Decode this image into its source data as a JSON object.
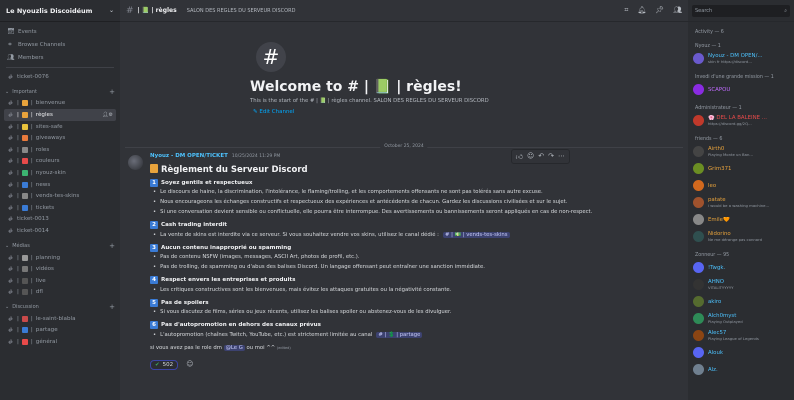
{
  "server": {
    "name": "Le Nyouzlis Discoidéum"
  },
  "nav": [
    "Events",
    "Browse Channels",
    "Members"
  ],
  "top_channel": "ticket-0076",
  "categories": [
    {
      "name": "Important",
      "channels": [
        {
          "name": "bienvenue",
          "emo": "#e8a33c"
        },
        {
          "name": "règles",
          "emo": "#e8a33c",
          "active": true
        },
        {
          "name": "sites-safe",
          "emo": "#e8c23c"
        },
        {
          "name": "giveaways",
          "emo": "#e87a3c"
        },
        {
          "name": "roles",
          "emo": "#888"
        },
        {
          "name": "couleurs",
          "emo": "#e84a4a"
        },
        {
          "name": "nyouz-skin",
          "emo": "#3cb371"
        },
        {
          "name": "news",
          "emo": "#3a7bd5"
        },
        {
          "name": "vends-tes-skins",
          "emo": "#888"
        },
        {
          "name": "tickets",
          "emo": "#3a7bd5"
        },
        {
          "name": "ticket-0013"
        },
        {
          "name": "ticket-0014"
        }
      ]
    },
    {
      "name": "Médias",
      "channels": [
        {
          "name": "planning",
          "emo": "#999"
        },
        {
          "name": "vidéos",
          "emo": "#777"
        },
        {
          "name": "live",
          "emo": "#555"
        },
        {
          "name": "dfl",
          "emo": "#555"
        }
      ]
    },
    {
      "name": "Discussion",
      "channels": [
        {
          "name": "le-saint-blabla",
          "emo": "#c94a4a"
        },
        {
          "name": "partage",
          "emo": "#3a7bd5"
        },
        {
          "name": "général",
          "emo": "#e84a4a"
        }
      ]
    }
  ],
  "header": {
    "channel": "| 📗 | règles",
    "topic": "SALON DES REGLES DU SERVEUR DISCORD",
    "search_placeholder": "Search"
  },
  "welcome": {
    "title": "Welcome to # | 📗 | règles!",
    "sub": "This is the start of the # | 📗 | règles channel. SALON DES REGLES DU SERVEUR DISCORD",
    "edit": "Edit Channel"
  },
  "date_divider": "October 25, 2024",
  "message": {
    "author": "Nyouz - DM OPEN/TICKET",
    "time": "10/25/2024 11:29 PM",
    "title": "Règlement du Serveur Discord",
    "sections": [
      {
        "n": "1",
        "h": "Soyez gentils et respectueux",
        "lines": [
          "Le discours de haine, la discrimination, l'intolérance, le flaming/trolling, et les comportements offensants ne sont pas tolérés sans autre excuse.",
          "Nous encourageons les échanges constructifs et respectueux des expériences et antécédents de chacun. Gardez les discussions civilisées et sur le sujet.",
          "Si une conversation devient sensible ou conflictuelle, elle pourra être interrompue. Des avertissements ou bannissements seront appliqués en cas de non-respect."
        ]
      },
      {
        "n": "2",
        "h": "Cash trading interdit",
        "lines": [
          "La vente de skins est interdite via ce serveur. Si vous souhaitez vendre vos skins, utilisez le canal dédié :"
        ],
        "mention": "# | 💵 | vends-tes-skins"
      },
      {
        "n": "3",
        "h": "Aucun contenu inapproprié ou spamming",
        "lines": [
          "Pas de contenu NSFW (images, messages, ASCII Art, photos de profil, etc.).",
          "Pas de trolling, de spamming ou d'abus des balises Discord. Un langage offensant peut entraîner une sanction immédiate."
        ]
      },
      {
        "n": "4",
        "h": "Respect envers les entreprises et produits",
        "lines": [
          "Les critiques constructives sont les bienvenues, mais évitez les attaques gratuites ou la négativité constante."
        ]
      },
      {
        "n": "5",
        "h": "Pas de spoilers",
        "lines": [
          "Si vous discutez de films, séries ou jeux récents, utilisez les balises spoiler ou abstenez-vous de les divulguer."
        ]
      },
      {
        "n": "6",
        "h": "Pas d'autopromotion en dehors des canaux prévus",
        "lines": [
          "L'autopromotion (chaînes Twitch, YouTube, etc.) est strictement limitée au canal"
        ],
        "mention": "# | 💲 | partage"
      }
    ],
    "footer": "si vous avez pas le role dm",
    "footer_mention": "@Le G",
    "footer_end": "ou moi ^^",
    "edited": "(edited)",
    "reaction_count": "502"
  },
  "members": {
    "activity": "Activity — 6",
    "groups": [
      {
        "label": "Nyouz — 1",
        "items": [
          {
            "n": "Nyouz - DM OPEN/...",
            "s": "skin fr https://discord...",
            "c": "#4dc3ff",
            "a": "#6a5acd"
          }
        ]
      },
      {
        "label": "Invedi d'une grande mission — 1",
        "items": [
          {
            "n": "SCAPOU",
            "s": "",
            "c": "#c06bff",
            "a": "#8a2be2"
          }
        ]
      },
      {
        "label": "Administrateur — 1",
        "items": [
          {
            "n": "🌸 DEL LA BALEINE ...",
            "s": "https://discord.gg/2Q...",
            "c": "#e84a4a",
            "a": "#c0392b"
          }
        ]
      },
      {
        "label": "friends — 6",
        "items": [
          {
            "n": "Airth0",
            "s": "Playing Monte un Ban...",
            "c": "#e8a33c",
            "a": "#444"
          },
          {
            "n": "Grim371",
            "s": "",
            "c": "#e8a33c",
            "a": "#6b8e23"
          },
          {
            "n": "leo",
            "s": "",
            "c": "#e8a33c",
            "a": "#d2691e"
          },
          {
            "n": "patate",
            "s": "i would be a washing machine...",
            "c": "#e8a33c",
            "a": "#a0522d"
          },
          {
            "n": "Emile🧡",
            "s": "",
            "c": "#e8a33c",
            "a": "#888"
          },
          {
            "n": "Nidorino",
            "s": "Ne me dérange pas connard",
            "c": "#e8a33c",
            "a": "#2f4f4f"
          }
        ]
      },
      {
        "label": "Zonneur — 95",
        "items": [
          {
            "n": "!Twgk.",
            "s": "",
            "c": "#4dc3ff",
            "a": "#5865f2"
          },
          {
            "n": "AHNO",
            "s": "VITALITYYYYY",
            "c": "#4dc3ff",
            "a": "#333"
          },
          {
            "n": "akiro",
            "s": "",
            "c": "#4dc3ff",
            "a": "#556b2f"
          },
          {
            "n": "Alch0myst",
            "s": "Playing Outplayed",
            "c": "#4dc3ff",
            "a": "#2e8b57"
          },
          {
            "n": "Alec57",
            "s": "Playing League of Legends",
            "c": "#4dc3ff",
            "a": "#8b4513"
          },
          {
            "n": "Alouk",
            "s": "",
            "c": "#4dc3ff",
            "a": "#5865f2"
          },
          {
            "n": "Alz.",
            "s": "",
            "c": "#4dc3ff",
            "a": "#708090"
          }
        ]
      }
    ]
  }
}
